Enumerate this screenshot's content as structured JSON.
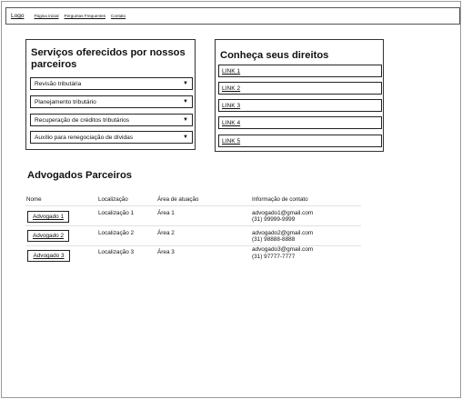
{
  "header": {
    "logo": "Logo",
    "nav": [
      "Página inicial",
      "Perguntas Frequentes",
      "Contato"
    ]
  },
  "services": {
    "title": "Serviços oferecidos por nossos parceiros",
    "items": [
      "Revisão tributária",
      "Planejamento tributário",
      "Recuperação de créditos tributários",
      "Auxílio para renegociação de dívidas"
    ],
    "caret_icon": "caret-down-icon"
  },
  "rights": {
    "title": "Conheça seus direitos",
    "links": [
      "LINK 1",
      "LINK 2",
      "LINK 3",
      "LINK 4",
      "LINK 5"
    ]
  },
  "lawyers": {
    "title": "Advogados Parceiros",
    "columns": [
      "Nome",
      "Localização",
      "Área de atuação",
      "Informação de contato"
    ],
    "rows": [
      {
        "name": "Advogado 1",
        "location": "Localização 1",
        "area": "Área 1",
        "email": "advogado1@gmail.com",
        "phone": "(31) 99999-9999"
      },
      {
        "name": "Advogado 2",
        "location": "Localização 2",
        "area": "Área 2",
        "email": "advogado2@gmail.com",
        "phone": "(31) 98888-8888"
      },
      {
        "name": "Advogado 3",
        "location": "Localização 3",
        "area": "Área 3",
        "email": "advogado3@gmail.com",
        "phone": "(31) 97777-7777"
      }
    ]
  }
}
